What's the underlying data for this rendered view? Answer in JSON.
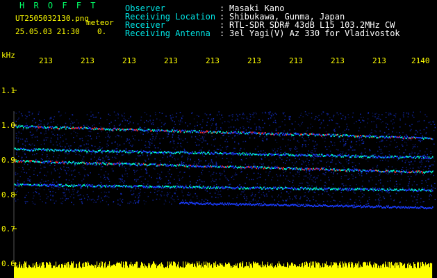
{
  "header": {
    "app_title": "H R O F F T",
    "file_name": "UT2505032130.png",
    "mode": "meteor",
    "datetime": "25.05.03 21:30",
    "counter": "0.",
    "fields": [
      {
        "label": "Observer",
        "value": "Masaki Kano"
      },
      {
        "label": "Receiving Location",
        "value": "Shibukawa, Gunma, Japan"
      },
      {
        "label": "Receiver",
        "value": "RTL-SDR SDR# 43dB L15 103.2MHz CW"
      },
      {
        "label": "Receiving Antenna",
        "value": "3el Yagi(V) Az 330 for Vladivostok"
      }
    ]
  },
  "axis": {
    "unit": "kHz",
    "y_ticks": [
      "1.1",
      "1.0",
      "0.9",
      "0.8",
      "0.7",
      "0.6"
    ],
    "x_ticks": [
      "213",
      "213",
      "213",
      "213",
      "213",
      "213",
      "213",
      "213",
      "213",
      "2140"
    ]
  },
  "colors": {
    "background": "#000000",
    "label_text": "#00e6e6",
    "value_text": "#ffffff",
    "axis_text": "#ffff00",
    "title_text": "#00ff66",
    "signal_low": "#1a3cff",
    "signal_mid": "#00ffcc",
    "signal_high": "#ff3030",
    "power_bar": "#ffff00"
  }
}
